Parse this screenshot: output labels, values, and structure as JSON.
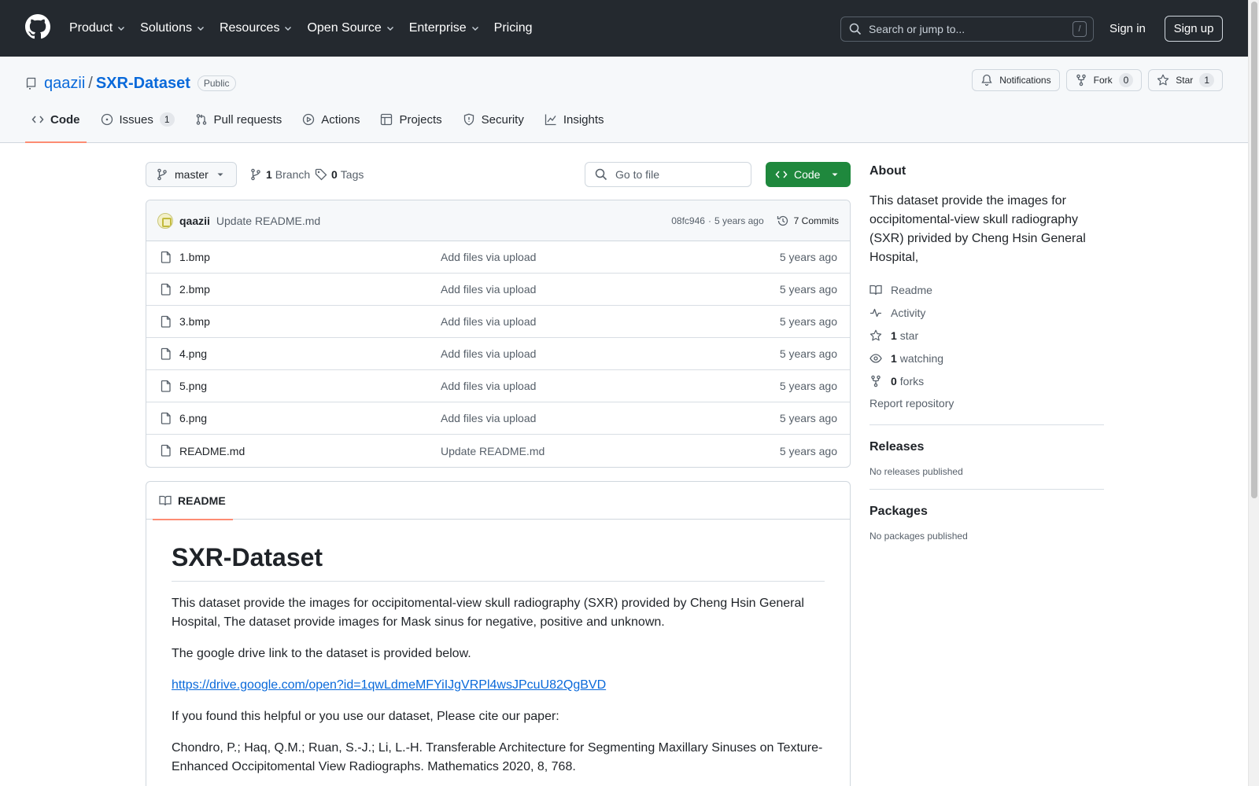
{
  "topnav": {
    "items": [
      {
        "label": "Product",
        "has_menu": true
      },
      {
        "label": "Solutions",
        "has_menu": true
      },
      {
        "label": "Resources",
        "has_menu": true
      },
      {
        "label": "Open Source",
        "has_menu": true
      },
      {
        "label": "Enterprise",
        "has_menu": true
      },
      {
        "label": "Pricing",
        "has_menu": false
      }
    ],
    "search_placeholder": "Search or jump to...",
    "search_shortcut": "/",
    "signin": "Sign in",
    "signup": "Sign up"
  },
  "repo": {
    "owner": "qaazii",
    "separator": "/",
    "name": "SXR-Dataset",
    "visibility": "Public",
    "notifications_label": "Notifications",
    "fork_label": "Fork",
    "fork_count": "0",
    "star_label": "Star",
    "star_count": "1"
  },
  "tabs": [
    {
      "label": "Code",
      "icon": "code-icon",
      "active": true
    },
    {
      "label": "Issues",
      "icon": "issue-icon",
      "count": "1"
    },
    {
      "label": "Pull requests",
      "icon": "pull-request-icon"
    },
    {
      "label": "Actions",
      "icon": "play-icon"
    },
    {
      "label": "Projects",
      "icon": "table-icon"
    },
    {
      "label": "Security",
      "icon": "shield-icon"
    },
    {
      "label": "Insights",
      "icon": "graph-icon"
    }
  ],
  "toolbar": {
    "branch": "master",
    "branch_count": "1",
    "branch_label": "Branch",
    "tag_count": "0",
    "tag_label": "Tags",
    "goto_placeholder": "Go to file",
    "code_button": "Code"
  },
  "latest_commit": {
    "author": "qaazii",
    "message": "Update README.md",
    "sha": "08fc946",
    "dot": "·",
    "time": "5 years ago",
    "commits_label": "7 Commits"
  },
  "files": [
    {
      "name": "1.bmp",
      "message": "Add files via upload",
      "time": "5 years ago"
    },
    {
      "name": "2.bmp",
      "message": "Add files via upload",
      "time": "5 years ago"
    },
    {
      "name": "3.bmp",
      "message": "Add files via upload",
      "time": "5 years ago"
    },
    {
      "name": "4.png",
      "message": "Add files via upload",
      "time": "5 years ago"
    },
    {
      "name": "5.png",
      "message": "Add files via upload",
      "time": "5 years ago"
    },
    {
      "name": "6.png",
      "message": "Add files via upload",
      "time": "5 years ago"
    },
    {
      "name": "README.md",
      "message": "Update README.md",
      "time": "5 years ago"
    }
  ],
  "readme": {
    "tab_label": "README",
    "title": "SXR-Dataset",
    "para1": "This dataset provide the images for occipitomental-view skull radiography (SXR) provided by Cheng Hsin General Hospital, The dataset provide images for Mask sinus for negative, positive and unknown.",
    "para2": "The google drive link to the dataset is provided below.",
    "link": "https://drive.google.com/open?id=1qwLdmeMFYiIJgVRPl4wsJPcuU82QgBVD",
    "para3": "If you found this helpful or you use our dataset, Please cite our paper:",
    "para4": "Chondro, P.; Haq, Q.M.; Ruan, S.-J.; Li, L.-H. Transferable Architecture for Segmenting Maxillary Sinuses on Texture-Enhanced Occipitomental View Radiographs. Mathematics 2020, 8, 768."
  },
  "sidebar": {
    "about_title": "About",
    "about_desc": "This dataset provide the images for occipitomental-view skull radiography (SXR) privided by Cheng Hsin General Hospital,",
    "readme_label": "Readme",
    "activity_label": "Activity",
    "stars_count": "1",
    "stars_label": "star",
    "watching_count": "1",
    "watching_label": "watching",
    "forks_count": "0",
    "forks_label": "forks",
    "report_label": "Report repository",
    "releases_title": "Releases",
    "releases_empty": "No releases published",
    "packages_title": "Packages",
    "packages_empty": "No packages published"
  },
  "colors": {
    "header_bg": "#24292f",
    "link": "#0969da",
    "code_button": "#1f883d",
    "active_tab_underline": "#fd8c73"
  }
}
